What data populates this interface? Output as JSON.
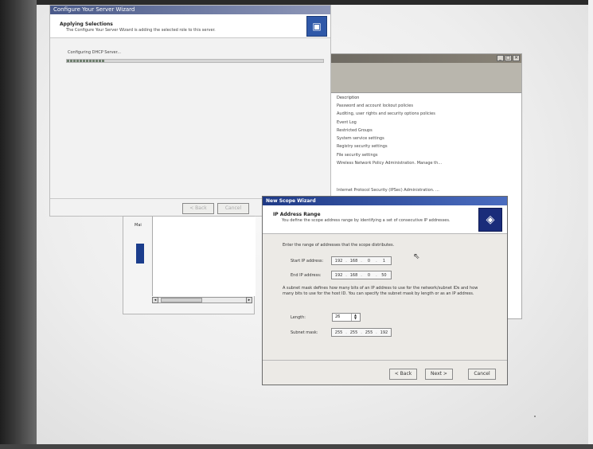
{
  "config_wizard": {
    "title": "Configure Your Server Wizard",
    "header_title": "Applying Selections",
    "header_sub": "The Configure Your Server Wizard is adding the selected role to this server.",
    "status": "Configuring DHCP Server...",
    "progress_pct": 15,
    "back_label": "< Back",
    "cancel_label": "Cancel"
  },
  "policy_window": {
    "column_header": "Description",
    "items": [
      "Password and account lockout policies",
      "Auditing, user rights and security options policies",
      "Event Log",
      "Restricted Groups",
      "System service settings",
      "Registry security settings",
      "File security settings",
      "Wireless Network Policy Administration. Manage th..."
    ],
    "extra_item": "Internet Protocol Security (IPSec) Administration. ..."
  },
  "mid_window": {
    "label": "Mai"
  },
  "scope_wizard": {
    "title": "New Scope Wizard",
    "header_title": "IP Address Range",
    "header_sub": "You define the scope address range by identifying a set of consecutive IP addresses.",
    "intro": "Enter the range of addresses that the scope distributes.",
    "start_ip_label": "Start IP address:",
    "start_ip": [
      "192",
      "168",
      "0",
      "1"
    ],
    "end_ip_label": "End IP address:",
    "end_ip": [
      "192",
      "168",
      "0",
      "50"
    ],
    "subnet_note": "A subnet mask defines how many bits of an IP address to use for the network/subnet IDs and how many bits to use for the host ID. You can specify the subnet mask by length or as an IP address.",
    "length_label": "Length:",
    "length_value": "26",
    "mask_label": "Subnet mask:",
    "mask": [
      "255",
      "255",
      "255",
      "192"
    ],
    "back_label": "< Back",
    "next_label": "Next >",
    "cancel_label": "Cancel"
  }
}
